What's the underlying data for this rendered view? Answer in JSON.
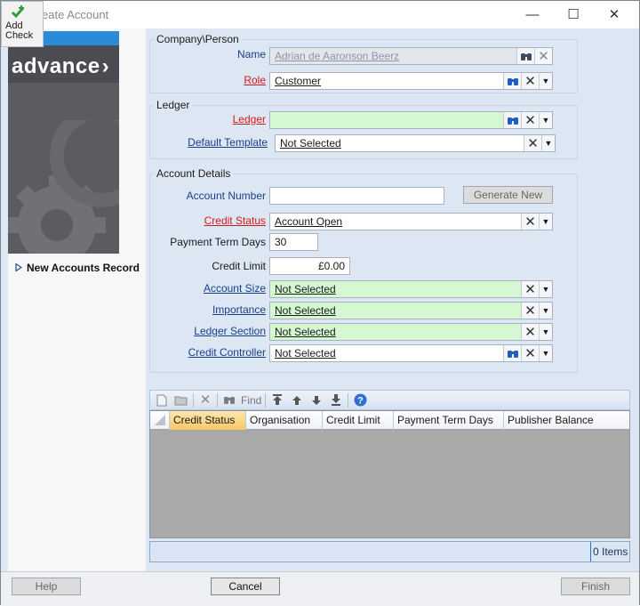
{
  "window": {
    "title": "eate Account",
    "controls": {
      "minimize": "—",
      "maximize": "☐",
      "close": "✕"
    }
  },
  "add_check": {
    "label_line1": "Add",
    "label_line2": "Check",
    "icon": "check-plus-icon"
  },
  "brand": {
    "text": "advance",
    "chevron": "›"
  },
  "nav": {
    "item_label": "New Accounts Record",
    "item_icon": "triangle-right-icon"
  },
  "company_person": {
    "legend": "Company\\Person",
    "name_label": "Name",
    "name_value": "Adrian de Aaronson Beerz",
    "role_label": "Role",
    "role_value": "Customer"
  },
  "ledger_group": {
    "legend": "Ledger",
    "ledger_label": "Ledger",
    "ledger_value": "",
    "template_label": "Default Template",
    "template_value": "Not Selected"
  },
  "account_details": {
    "legend": "Account Details",
    "account_number_label": "Account Number",
    "account_number_value": "",
    "generate_new_label": "Generate New",
    "credit_status_label": "Credit Status",
    "credit_status_value": "Account Open",
    "payment_term_label": "Payment Term Days",
    "payment_term_value": "30",
    "credit_limit_label": "Credit Limit",
    "credit_limit_value": "£0.00",
    "account_size_label": "Account Size",
    "account_size_value": "Not Selected",
    "importance_label": "Importance",
    "importance_value": "Not Selected",
    "ledger_section_label": "Ledger Section",
    "ledger_section_value": "Not Selected",
    "credit_controller_label": "Credit Controller",
    "credit_controller_value": "Not Selected"
  },
  "grid_toolbar": {
    "find_label": "Find"
  },
  "grid": {
    "columns": [
      "Credit Status",
      "Organisation",
      "Credit Limit",
      "Payment Term Days",
      "Publisher Balance"
    ],
    "item_count": "0 Items"
  },
  "footer": {
    "help": "Help",
    "cancel": "Cancel",
    "finish": "Finish"
  },
  "colors": {
    "required_label": "#d21a1a",
    "link_label": "#1a3f8a",
    "mandatory_field_bg": "#d5f7d2",
    "content_bg": "#dde7f4"
  }
}
